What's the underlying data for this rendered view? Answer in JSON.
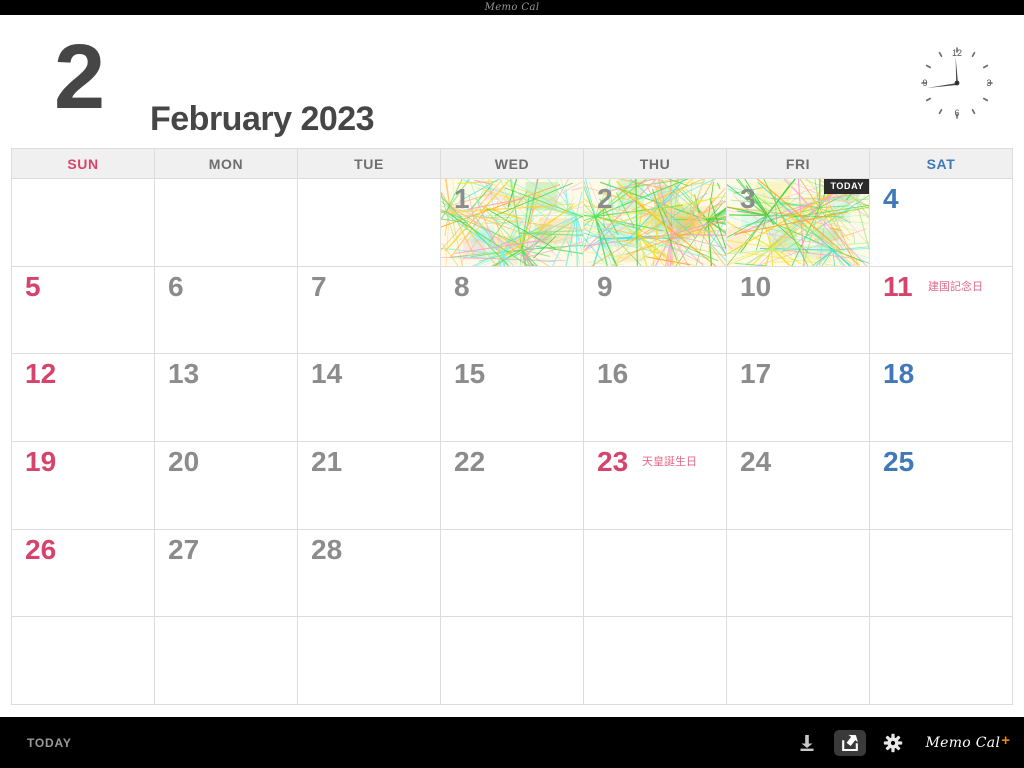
{
  "statusbar": {
    "title": "Memo Cal"
  },
  "header": {
    "month_number": "2",
    "month_label": "February 2023",
    "clock": {
      "n12": "12",
      "n3": "3",
      "n6": "6",
      "n9": "9"
    }
  },
  "calendar": {
    "weekdays": [
      {
        "label": "SUN",
        "kind": "sun"
      },
      {
        "label": "MON",
        "kind": "wd"
      },
      {
        "label": "TUE",
        "kind": "wd"
      },
      {
        "label": "WED",
        "kind": "wd"
      },
      {
        "label": "THU",
        "kind": "wd"
      },
      {
        "label": "FRI",
        "kind": "wd"
      },
      {
        "label": "SAT",
        "kind": "sat"
      }
    ],
    "today_badge": "TODAY",
    "weeks": [
      [
        {
          "num": "",
          "kind": "sun"
        },
        {
          "num": "",
          "kind": "wd"
        },
        {
          "num": "",
          "kind": "wd"
        },
        {
          "num": "1",
          "kind": "wd",
          "memo": true
        },
        {
          "num": "2",
          "kind": "wd",
          "memo": true
        },
        {
          "num": "3",
          "kind": "wd",
          "memo": true,
          "today": true
        },
        {
          "num": "4",
          "kind": "sat"
        }
      ],
      [
        {
          "num": "5",
          "kind": "sun"
        },
        {
          "num": "6",
          "kind": "wd"
        },
        {
          "num": "7",
          "kind": "wd"
        },
        {
          "num": "8",
          "kind": "wd"
        },
        {
          "num": "9",
          "kind": "wd"
        },
        {
          "num": "10",
          "kind": "wd"
        },
        {
          "num": "11",
          "kind": "holiday",
          "holiday": "建国記念日"
        }
      ],
      [
        {
          "num": "12",
          "kind": "sun"
        },
        {
          "num": "13",
          "kind": "wd"
        },
        {
          "num": "14",
          "kind": "wd"
        },
        {
          "num": "15",
          "kind": "wd"
        },
        {
          "num": "16",
          "kind": "wd"
        },
        {
          "num": "17",
          "kind": "wd"
        },
        {
          "num": "18",
          "kind": "sat"
        }
      ],
      [
        {
          "num": "19",
          "kind": "sun"
        },
        {
          "num": "20",
          "kind": "wd"
        },
        {
          "num": "21",
          "kind": "wd"
        },
        {
          "num": "22",
          "kind": "wd"
        },
        {
          "num": "23",
          "kind": "holiday",
          "holiday": "天皇誕生日"
        },
        {
          "num": "24",
          "kind": "wd"
        },
        {
          "num": "25",
          "kind": "sat"
        }
      ],
      [
        {
          "num": "26",
          "kind": "sun"
        },
        {
          "num": "27",
          "kind": "wd"
        },
        {
          "num": "28",
          "kind": "wd"
        },
        {
          "num": "",
          "kind": "wd"
        },
        {
          "num": "",
          "kind": "wd"
        },
        {
          "num": "",
          "kind": "wd"
        },
        {
          "num": "",
          "kind": "sat"
        }
      ],
      [
        {
          "num": "",
          "kind": "sun"
        },
        {
          "num": "",
          "kind": "wd"
        },
        {
          "num": "",
          "kind": "wd"
        },
        {
          "num": "",
          "kind": "wd"
        },
        {
          "num": "",
          "kind": "wd"
        },
        {
          "num": "",
          "kind": "wd"
        },
        {
          "num": "",
          "kind": "sat"
        }
      ]
    ]
  },
  "toolbar": {
    "today_label": "TODAY",
    "icons": [
      "stamp-icon",
      "share-icon",
      "gear-icon"
    ],
    "brand_text": "Memo Cal",
    "brand_plus": "+"
  },
  "colors": {
    "sunday": "#d6436b",
    "saturday": "#4179b8",
    "weekday": "#8c8c8c",
    "holiday_label": "#e06a8a",
    "accent_plus": "#e8860f",
    "grid_line": "#dcdcdc",
    "header_bg": "#f0f0f0",
    "toolbar_bg": "#000000"
  }
}
